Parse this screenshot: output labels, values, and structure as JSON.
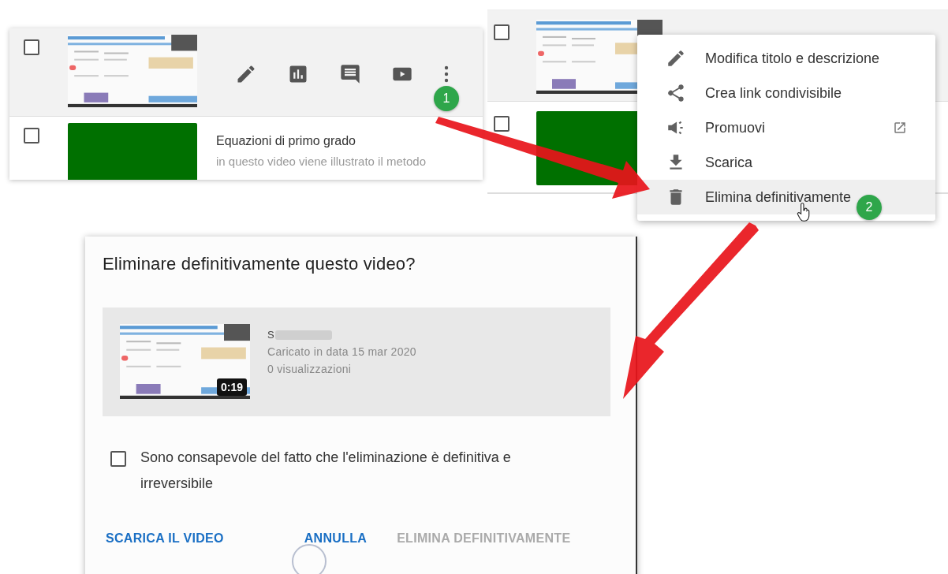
{
  "list_panel": {
    "rows": [
      {
        "kind": "actions",
        "checked": false
      },
      {
        "kind": "info",
        "checked": false,
        "title": "Equazioni di primo grado",
        "description": "in questo video viene illustrato il metodo"
      }
    ],
    "step_badge": "1"
  },
  "menu_panel": {
    "rows": [
      {
        "checked": false
      },
      {
        "checked": false
      }
    ],
    "menu": {
      "items": [
        {
          "label": "Modifica titolo e descrizione",
          "external": false,
          "selected": false
        },
        {
          "label": "Crea link condivisibile",
          "external": false,
          "selected": false
        },
        {
          "label": "Promuovi",
          "external": true,
          "selected": false
        },
        {
          "label": "Scarica",
          "external": false,
          "selected": false
        },
        {
          "label": "Elimina definitivamente",
          "external": false,
          "selected": true
        }
      ]
    },
    "step_badge": "2"
  },
  "dialog": {
    "title": "Eliminare definitivamente questo video?",
    "video": {
      "title": "S",
      "uploaded": "Caricato in data 15 mar 2020",
      "views": "0 visualizzazioni",
      "duration": "0:19"
    },
    "confirm": {
      "label": "Sono consapevole del fatto che l'eliminazione è definitiva e irreversibile",
      "checked": false
    },
    "buttons": [
      {
        "label": "SCARICA IL VIDEO",
        "disabled": false
      },
      {
        "label": "ANNULLA",
        "disabled": false
      },
      {
        "label": "ELIMINA DEFINITIVAMENTE",
        "disabled": true
      }
    ]
  }
}
